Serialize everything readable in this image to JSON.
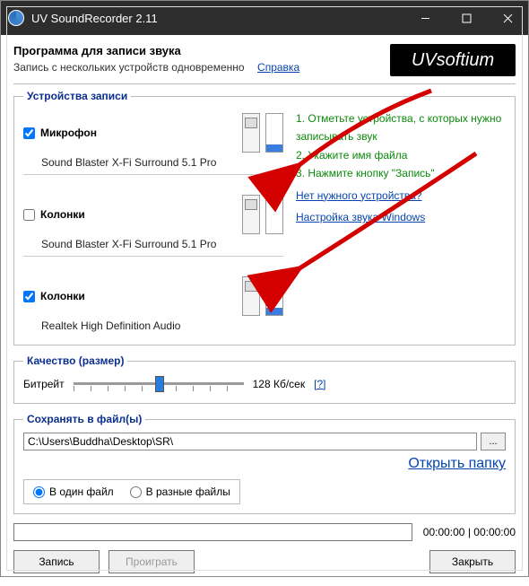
{
  "window": {
    "title": "UV SoundRecorder 2.11"
  },
  "brand": "UVsoftium",
  "header": {
    "title": "Программа для записи звука",
    "subtitle": "Запись с нескольких устройств одновременно",
    "help": "Справка"
  },
  "devices": {
    "legend": "Устройства записи",
    "list": [
      {
        "checked": true,
        "name": "Микрофон",
        "sub": "Sound Blaster X-Fi Surround 5.1 Pro",
        "level": true
      },
      {
        "checked": false,
        "name": "Колонки",
        "sub": "Sound Blaster X-Fi Surround 5.1 Pro",
        "level": false
      },
      {
        "checked": true,
        "name": "Колонки",
        "sub": "Realtek High Definition Audio",
        "level": true
      }
    ],
    "tips": {
      "t1": "1. Отметьте устройства, с которых нужно записывать звук",
      "t2": "2. Укажите имя файла",
      "t3": "3. Нажмите кнопку \"Запись\"",
      "l1": "Нет нужного устройства?",
      "l2": "Настройка звука Windows"
    }
  },
  "quality": {
    "legend": "Качество (размер)",
    "label": "Битрейт",
    "value": "128 Кб/сек",
    "help": "[?]"
  },
  "save": {
    "legend": "Сохранять в файл(ы)",
    "path": "C:\\Users\\Buddha\\Desktop\\SR\\",
    "browse": "...",
    "open": "Открыть папку",
    "mode_one": "В один файл",
    "mode_many": "В разные файлы"
  },
  "time": {
    "elapsed": "00:00:00",
    "total": "00:00:00"
  },
  "buttons": {
    "record": "Запись",
    "play": "Проиграть",
    "close": "Закрыть"
  }
}
